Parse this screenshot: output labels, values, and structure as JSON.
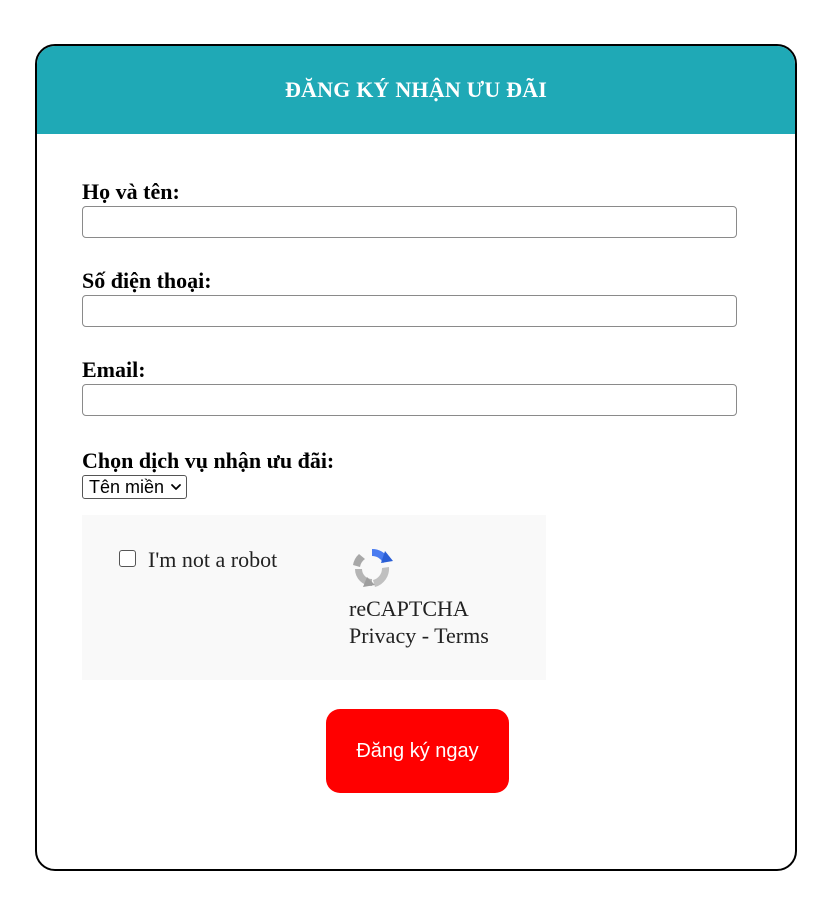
{
  "header": {
    "title": "ĐĂNG KÝ NHẬN ƯU ĐÃI"
  },
  "form": {
    "name_label": "Họ và tên:",
    "name_value": "",
    "phone_label": "Số điện thoại:",
    "phone_value": "",
    "email_label": "Email:",
    "email_value": "",
    "service_label": "Chọn dịch vụ nhận ưu đãi:",
    "service_selected": "Tên miền"
  },
  "captcha": {
    "checkbox_label": "I'm not a robot",
    "brand": "reCAPTCHA",
    "privacy": "Privacy",
    "separator": " - ",
    "terms": "Terms",
    "icon": "recaptcha-logo"
  },
  "submit": {
    "label": "Đăng ký ngay"
  },
  "colors": {
    "header_bg": "#1fa9b6",
    "submit_bg": "#ff0000",
    "captcha_bg": "#f9f9f9"
  }
}
